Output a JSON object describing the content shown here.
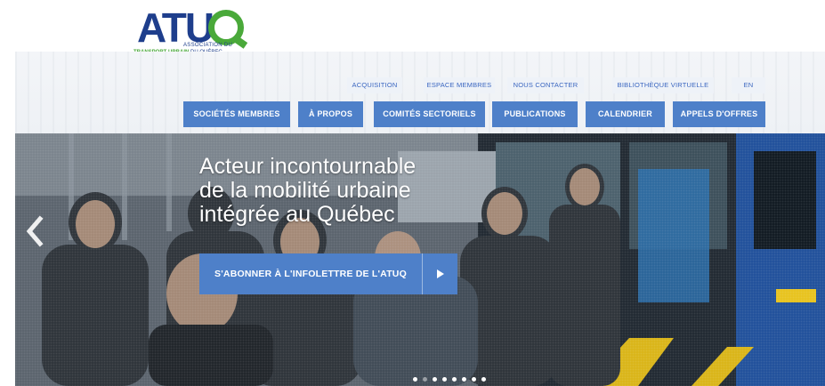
{
  "logo": {
    "word": "ATU",
    "line1": "ASSOCIATION DU",
    "line2_bold": "TRANSPORT URBAIN",
    "line2_rest": " DU QUÉBEC",
    "colors": {
      "navy": "#1e3e8c",
      "green": "#4aa93a"
    }
  },
  "top_links": [
    {
      "label": "ACQUISITION"
    },
    {
      "label": "ESPACE MEMBRES"
    },
    {
      "label": "NOUS CONTACTER"
    },
    {
      "label": "BIBLIOTHÈQUE VIRTUELLE"
    },
    {
      "label": "EN"
    }
  ],
  "main_nav": [
    {
      "label": "SOCIÉTÉS MEMBRES"
    },
    {
      "label": "À PROPOS"
    },
    {
      "label": "COMITÉS SECTORIELS"
    },
    {
      "label": "PUBLICATIONS"
    },
    {
      "label": "CALENDRIER"
    },
    {
      "label": "APPELS D'OFFRES"
    }
  ],
  "hero": {
    "title_lines": [
      "Acteur incontournable",
      "de la mobilité urbaine",
      "intégrée au Québec"
    ],
    "cta_label": "S'ABONNER À L'INFOLETTRE DE L'ATUQ",
    "icons": {
      "prev": "chevron-left-icon",
      "cta": "play-icon"
    },
    "slide_count": 8,
    "active_slide": 2
  },
  "colors": {
    "accent": "#4e80c9",
    "link": "#3a66c0"
  }
}
